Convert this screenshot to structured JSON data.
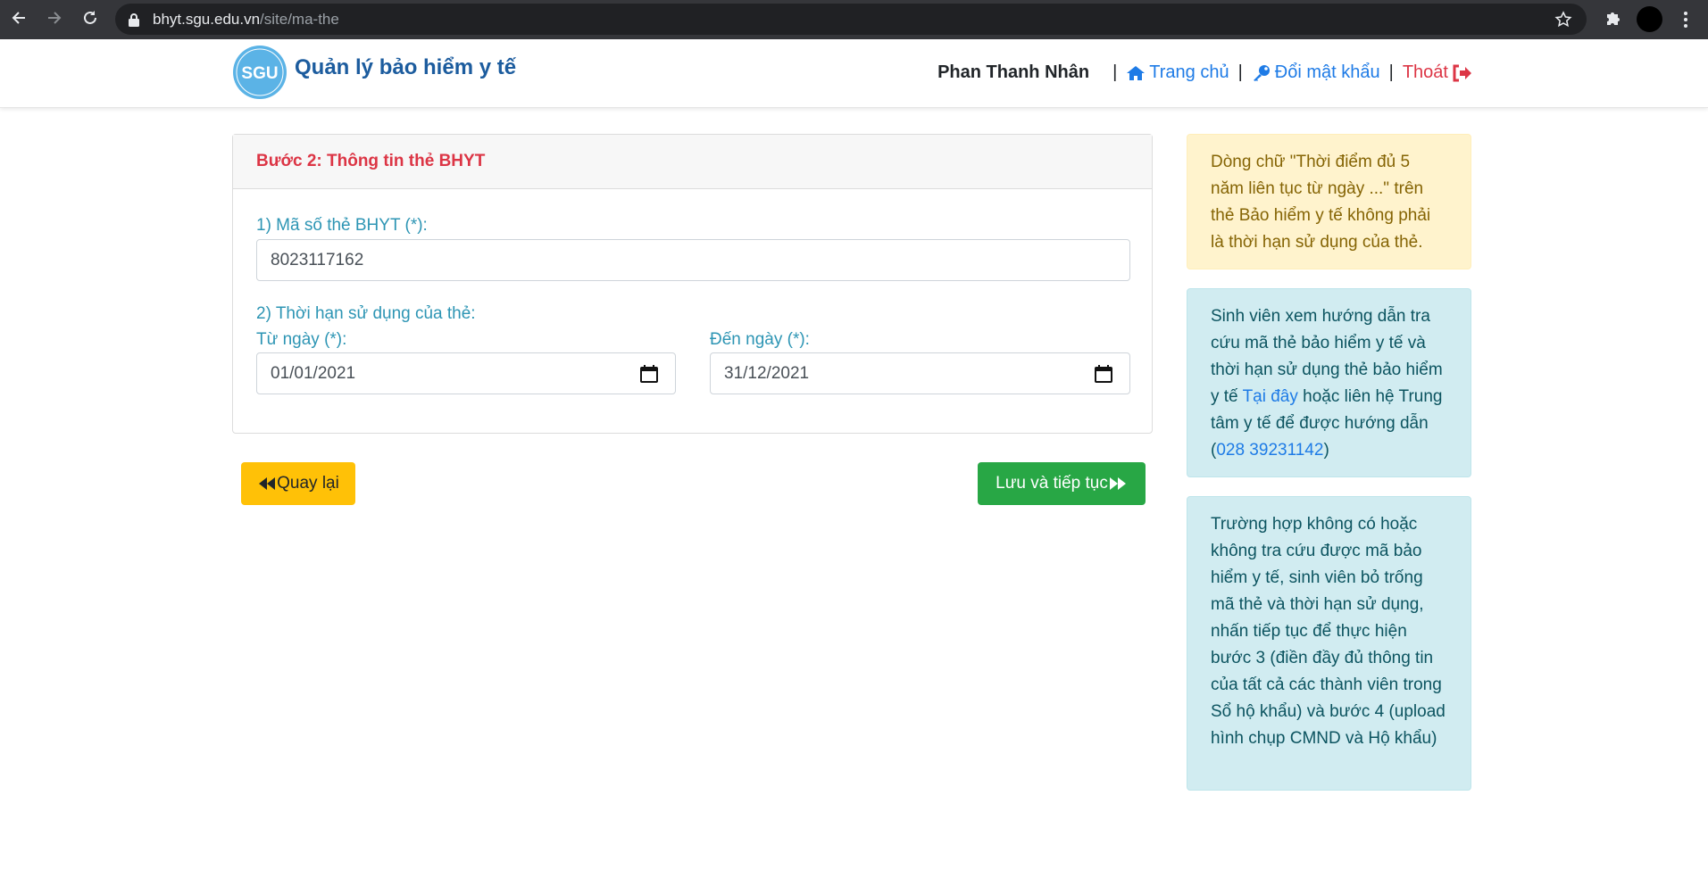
{
  "browser": {
    "url_host": "bhyt.sgu.edu.vn",
    "url_path": "/site/ma-the"
  },
  "header": {
    "logo_text": "SGU",
    "site_title": "Quản lý bảo hiểm y tế",
    "user_name": "Phan Thanh Nhân",
    "nav": {
      "separator": "|",
      "home": "Trang chủ",
      "change_password": "Đổi mật khẩu",
      "logout": "Thoát"
    }
  },
  "card": {
    "title": "Bước 2: Thông tin thẻ BHYT",
    "card_number_label": "1) Mã số thẻ BHYT (*):",
    "card_number_value": "8023117162",
    "validity_label": "2) Thời hạn sử dụng của thẻ:",
    "from_label": "Từ ngày (*):",
    "from_value": "01/01/2021",
    "to_label": "Đến ngày (*):",
    "to_value": "31/12/2021"
  },
  "buttons": {
    "back": "Quay lại",
    "save_next": "Lưu và tiếp tục"
  },
  "alerts": {
    "warning": "Dòng chữ \"Thời điểm đủ 5 năm liên tục từ ngày ...\" trên thẻ Bảo hiểm y tế không phải là thời hạn sử dụng của thẻ.",
    "info1_before_link": "Sinh viên xem hướng dẫn tra cứu mã thẻ bảo hiểm y tế và thời hạn sử dụng thẻ bảo hiểm y tế ",
    "info1_link": "Tại đây",
    "info1_middle": " hoặc liên hệ Trung tâm y tế để được hướng dẫn (",
    "info1_phone": "028 39231142",
    "info1_end": ")",
    "info2": "Trường hợp không có hoặc không tra cứu được mã bảo hiểm y tế, sinh viên bỏ trống mã thẻ và thời hạn sử dụng, nhấn tiếp tục để thực hiện bước 3 (điền đầy đủ thông tin của tất cả các thành viên trong Sổ hộ khẩu) và bước 4 (upload hình chụp CMND và Hộ khẩu)"
  },
  "colors": {
    "brand": "#1c5c9e",
    "link": "#1e7be6",
    "danger": "#dc3545",
    "label": "#2d95b4",
    "warning_btn": "#ffc107",
    "success_btn": "#28a745"
  }
}
